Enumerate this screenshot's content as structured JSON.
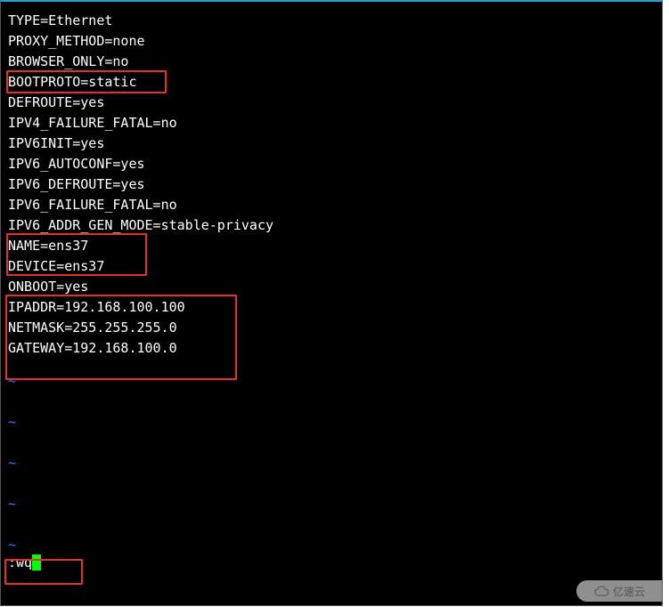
{
  "config_lines": {
    "l1": "TYPE=Ethernet",
    "l2": "PROXY_METHOD=none",
    "l3": "BROWSER_ONLY=no",
    "l4": "BOOTPROTO=static",
    "l5": "DEFROUTE=yes",
    "l6": "IPV4_FAILURE_FATAL=no",
    "l7": "IPV6INIT=yes",
    "l8": "IPV6_AUTOCONF=yes",
    "l9": "IPV6_DEFROUTE=yes",
    "l10": "IPV6_FAILURE_FATAL=no",
    "l11": "IPV6_ADDR_GEN_MODE=stable-privacy",
    "l12": "NAME=ens37",
    "l13": "DEVICE=ens37",
    "l14": "ONBOOT=yes",
    "l15": "IPADDR=192.168.100.100",
    "l16": "NETMASK=255.255.255.0",
    "l17": "GATEWAY=192.168.100.0"
  },
  "tilde": "~",
  "command": ":wq",
  "watermark": "亿速云"
}
